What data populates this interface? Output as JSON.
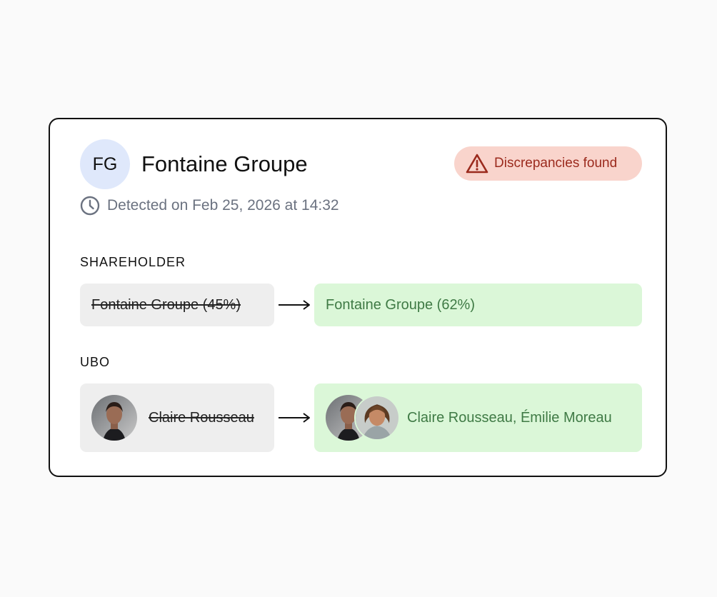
{
  "company": {
    "initials": "FG",
    "name": "Fontaine Groupe"
  },
  "badge": {
    "label": "Discrepancies found",
    "icon": "warning-triangle-icon",
    "color": "#9b2a1d",
    "background": "#f9d4cc"
  },
  "detected": {
    "icon": "clock-icon",
    "text": "Detected on Feb 25, 2026 at 14:32"
  },
  "shareholder": {
    "section_label": "SHAREHOLDER",
    "old_value": "Fontaine Groupe (45%)",
    "new_value": "Fontaine Groupe (62%)"
  },
  "ubo": {
    "section_label": "UBO",
    "old_value": "Claire Rousseau",
    "new_value": "Claire Rousseau, Émilie Moreau"
  },
  "colors": {
    "added_background": "#dbf7d8",
    "added_text": "#3f7a45",
    "removed_background": "#eeeeee",
    "initials_background": "#dfe8fb"
  }
}
